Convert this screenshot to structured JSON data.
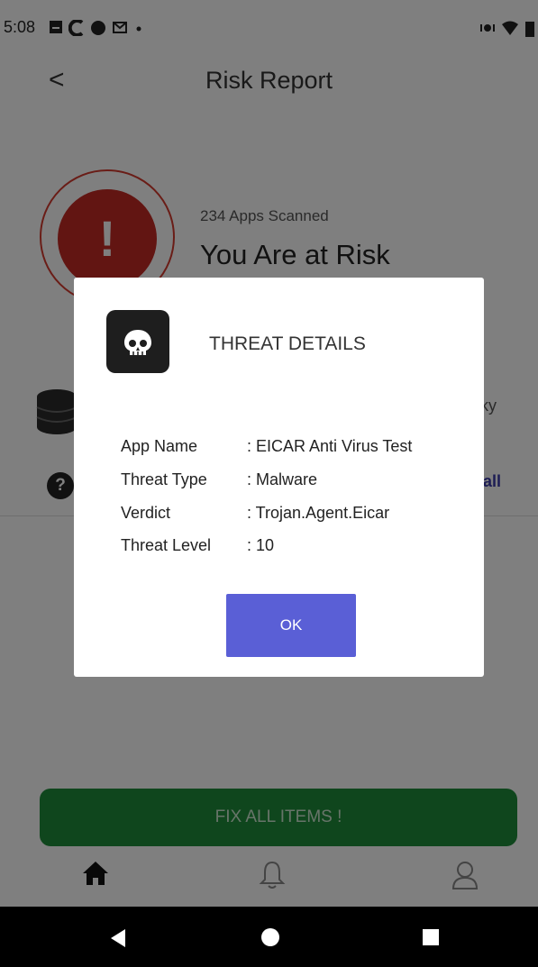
{
  "status_bar": {
    "time": "5:08"
  },
  "header": {
    "back_glyph": "<",
    "title": "Risk Report"
  },
  "summary": {
    "apps_scanned": "234 Apps Scanned",
    "status": "You Are at Risk",
    "alert_glyph": "!"
  },
  "behind_dialog": {
    "risky_label": "isky",
    "uninstall_label": "stall",
    "help_glyph": "?"
  },
  "fix_button": {
    "label": "FIX ALL ITEMS !"
  },
  "dialog": {
    "title": "THREAT DETAILS",
    "rows": [
      {
        "key": "App Name",
        "value": ":  EICAR Anti Virus Test"
      },
      {
        "key": "Threat Type",
        "value": ": Malware"
      },
      {
        "key": "Verdict",
        "value": ": Trojan.Agent.Eicar"
      },
      {
        "key": "Threat Level",
        "value": ": 10"
      }
    ],
    "ok_label": "OK"
  },
  "bottom_nav": {
    "items": [
      "home-icon",
      "bell-icon",
      "profile-icon"
    ]
  },
  "colors": {
    "risk_red": "#c42a24",
    "ok_button": "#5a5fd6",
    "fix_green": "#1f8c3a"
  }
}
